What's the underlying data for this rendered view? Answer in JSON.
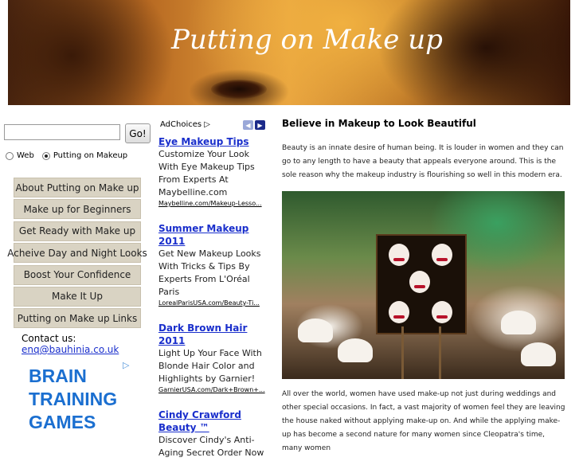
{
  "header": {
    "title": "Putting on Make up"
  },
  "search": {
    "placeholder": "",
    "value": "",
    "go_label": "Go!",
    "options": [
      {
        "label": "Web",
        "selected": false
      },
      {
        "label": "Putting on Makeup",
        "selected": true
      }
    ]
  },
  "nav": {
    "items": [
      "About Putting on Make up",
      "Make up for Beginners",
      "Get Ready with Make up",
      "Acheive Day and Night Looks",
      "Boost Your Confidence",
      "Make It Up",
      "Putting on Make up Links"
    ],
    "bg_color": "#d9d3c3"
  },
  "contact": {
    "label": "Contact us:",
    "email": "enq@bauhinia.co.uk"
  },
  "brain_ad": {
    "lines": [
      "BRAIN",
      "TRAINING",
      "GAMES"
    ],
    "color": "#1b6fd0"
  },
  "ads": {
    "adchoices_label": "AdChoices",
    "items": [
      {
        "title": "Eye Makeup Tips",
        "desc": "Customize Your Look With Eye Makeup Tips From Experts At Maybelline.com",
        "url": "Maybelline.com/Makeup-Lesso..."
      },
      {
        "title": "Summer Makeup 2011",
        "desc": "Get New Makeup Looks With Tricks & Tips By Experts From L'Oréal Paris",
        "url": "LorealParisUSA.com/Beauty-Ti..."
      },
      {
        "title": "Dark Brown Hair 2011",
        "desc": "Light Up Your Face With Blonde Hair Color and Highlights by Garnier!",
        "url": "GarnierUSA.com/Dark+Brown+..."
      },
      {
        "title": "Cindy Crawford Beauty ™",
        "desc": "Discover Cindy's Anti-Aging Secret Order Now",
        "url": ""
      }
    ],
    "link_color": "#1a2fcc"
  },
  "main": {
    "title": "Believe in Makeup to Look Beautiful",
    "intro": "Beauty is an innate desire of human being. It is louder in women and they can go to any length to have a beauty that appeals everyone around. This is the sole reason why the makeup industry is flourishing so well in this modern era.",
    "body": "All over the world, women have used make-up not just during weddings and other special occasions. In fact, a vast majority of women feel they are leaving the house naked without applying make-up on. And while the applying make-up has become a second nature for many women since Cleopatra's time, many women"
  }
}
